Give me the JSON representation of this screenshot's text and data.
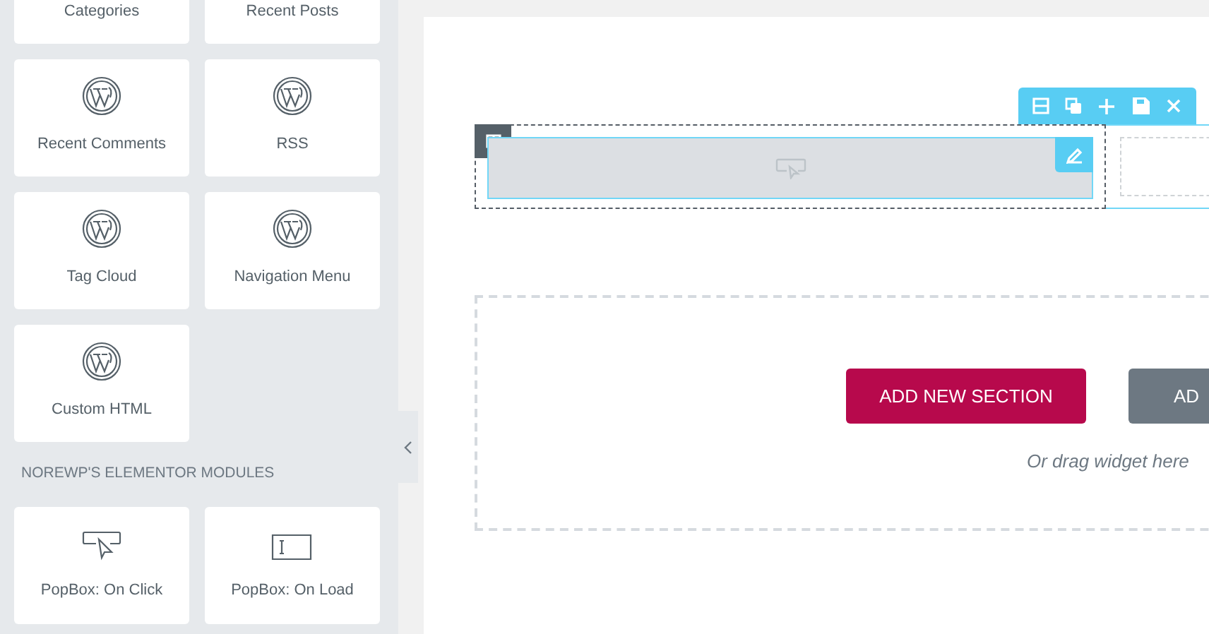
{
  "widget_panel": {
    "widgets": [
      {
        "label": "Categories"
      },
      {
        "label": "Recent Posts"
      },
      {
        "label": "Recent Comments",
        "kind": "wordpress"
      },
      {
        "label": "RSS",
        "kind": "wordpress"
      },
      {
        "label": "Tag Cloud",
        "kind": "wordpress"
      },
      {
        "label": "Navigation Menu",
        "kind": "wordpress"
      },
      {
        "label": "Custom HTML",
        "kind": "wordpress"
      }
    ],
    "section_heading": "NOREWP'S ELEMENTOR MODULES",
    "module_widgets": [
      {
        "label": "PopBox: On Click",
        "kind": "popup-click"
      },
      {
        "label": "PopBox: On Load",
        "kind": "popup-window"
      }
    ]
  },
  "canvas": {
    "section_toolbar": {
      "tools": [
        {
          "kind": "structure"
        },
        {
          "kind": "duplicate"
        },
        {
          "kind": "add"
        },
        {
          "kind": "save"
        },
        {
          "kind": "delete"
        }
      ]
    },
    "add_section": {
      "buttons": [
        {
          "label": "ADD NEW SECTION",
          "kind": "primary"
        },
        {
          "label": "AD",
          "kind": "secondary"
        }
      ],
      "hint": "Or drag widget here"
    }
  }
}
